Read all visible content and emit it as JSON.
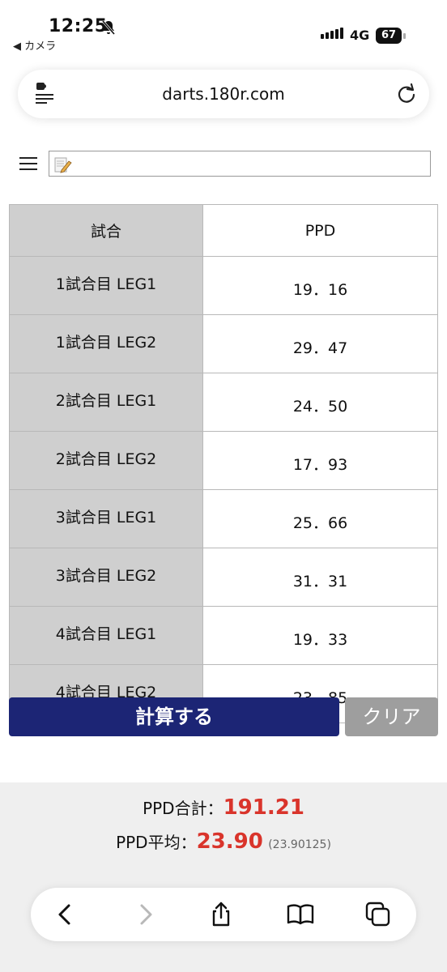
{
  "status_bar": {
    "time": "12:25",
    "back_app": "◀ カメラ",
    "network": "4G",
    "battery": "67"
  },
  "browser": {
    "url": "darts.180r.com"
  },
  "table": {
    "headers": [
      "試合",
      "PPD"
    ],
    "rows": [
      {
        "label": "1試合目 LEG1",
        "value": "19．16"
      },
      {
        "label": "1試合目 LEG2",
        "value": "29．47"
      },
      {
        "label": "2試合目 LEG1",
        "value": "24．50"
      },
      {
        "label": "2試合目 LEG2",
        "value": "17．93"
      },
      {
        "label": "3試合目 LEG1",
        "value": "25．66"
      },
      {
        "label": "3試合目 LEG2",
        "value": "31．31"
      },
      {
        "label": "4試合目 LEG1",
        "value": "19．33"
      },
      {
        "label": "4試合目 LEG2",
        "value": "23．85"
      }
    ]
  },
  "buttons": {
    "calculate": "計算する",
    "clear": "クリア"
  },
  "results": {
    "total_label": "PPD合計：",
    "total_value": "191.21",
    "average_label": "PPD平均：",
    "average_value": "23.90",
    "average_exact": "(23.90125)"
  },
  "colors": {
    "calc_button": "#1c2575",
    "clear_button": "#9e9e9e",
    "result_red": "#d9342b",
    "label_cell": "#cfcfcf"
  }
}
